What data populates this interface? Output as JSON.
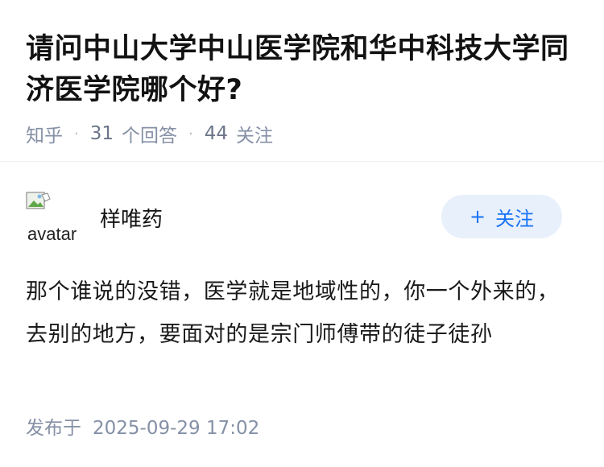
{
  "question": {
    "title": "请问中山大学中山医学院和华中科技大学同济医学院哪个好?",
    "source": "知乎",
    "answer_count": "31",
    "answer_label": "个回答",
    "follower_count": "44",
    "follower_label": "关注"
  },
  "answer": {
    "author_name": "样唯药",
    "avatar_alt": "avatar",
    "follow_label": "关注",
    "content": "那个谁说的没错，医学就是地域性的，你一个外来的，去别的地方，要面对的是宗门师傅带的徒子徒孙",
    "publish_label": "发布于",
    "publish_time": "2025-09-29 17:02"
  },
  "colors": {
    "title": "#121212",
    "meta": "#8590a6",
    "accent": "#1772f6",
    "follow_bg": "#e8f0fb"
  }
}
